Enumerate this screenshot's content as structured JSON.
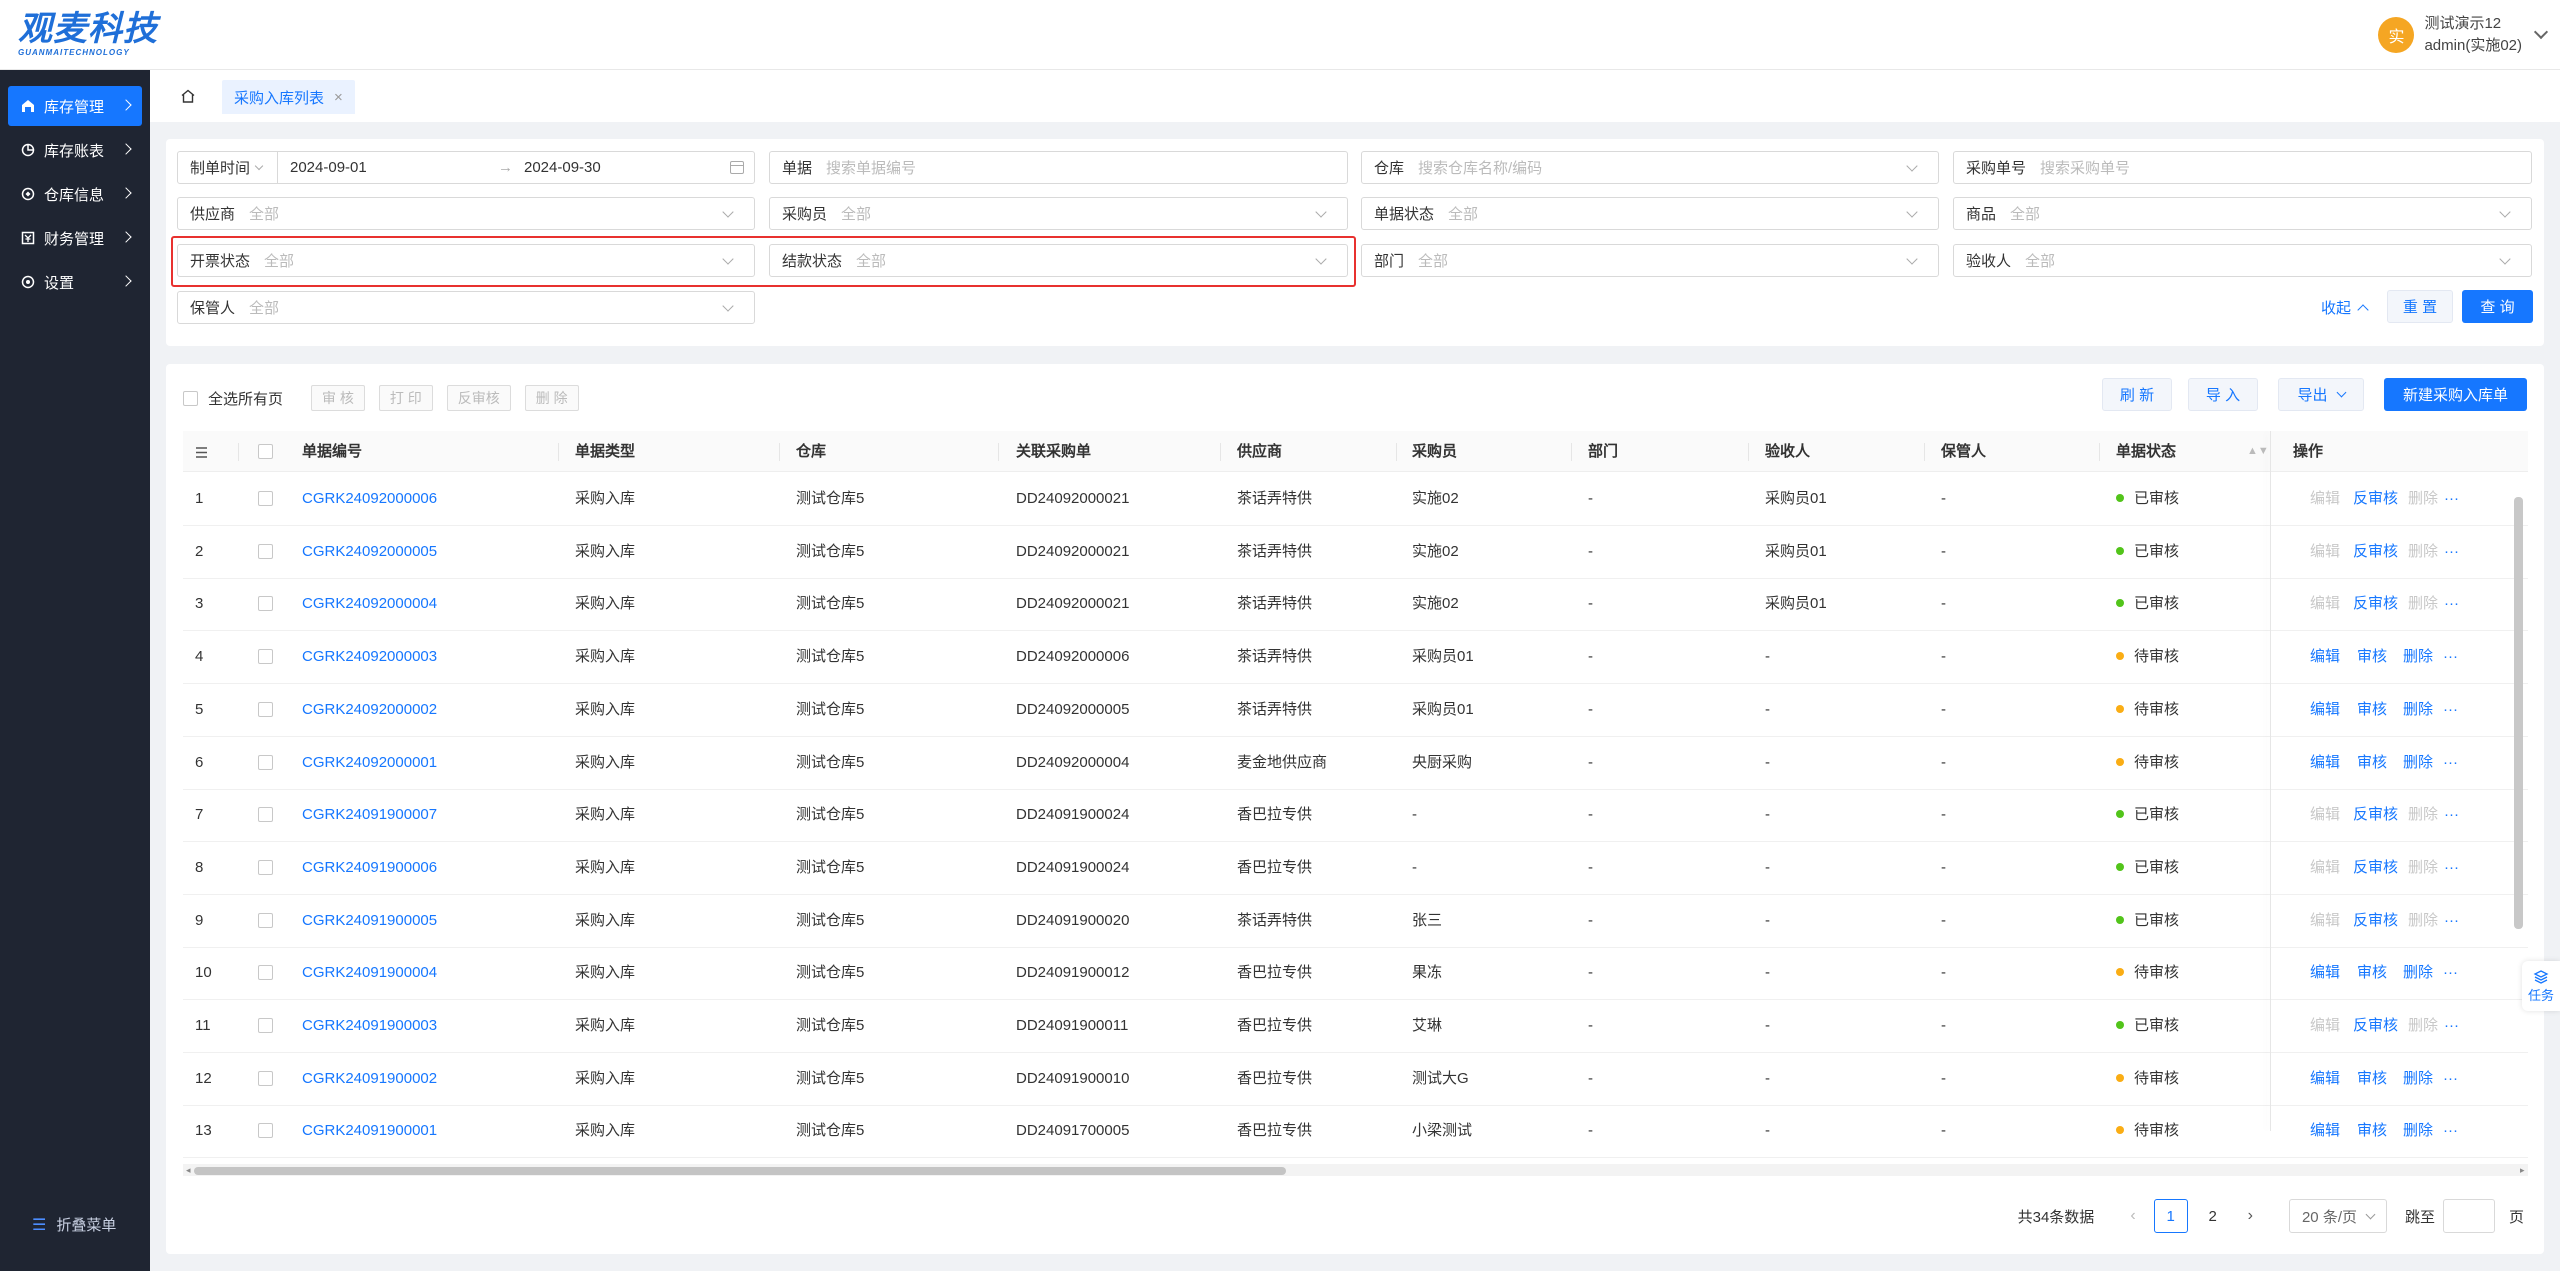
{
  "header": {
    "logo_main": "观麦科技",
    "logo_sub": "GUANMAITECHNOLOGY",
    "avatar_text": "实",
    "user_name": "测试演示12",
    "user_account": "admin(实施02)"
  },
  "sidebar": {
    "items": [
      {
        "label": "库存管理",
        "icon": "warehouse-icon"
      },
      {
        "label": "库存账表",
        "icon": "chart-icon"
      },
      {
        "label": "仓库信息",
        "icon": "info-icon"
      },
      {
        "label": "财务管理",
        "icon": "finance-icon"
      },
      {
        "label": "设置",
        "icon": "settings-icon"
      }
    ],
    "collapse_label": "折叠菜单"
  },
  "tabs": {
    "active_label": "采购入库列表",
    "close": "×"
  },
  "filters": {
    "date_type": "制单时间",
    "date_start": "2024-09-01",
    "date_arrow": "→",
    "date_end": "2024-09-30",
    "doc_label": "单据",
    "doc_placeholder": "搜索单据编号",
    "warehouse_label": "仓库",
    "warehouse_placeholder": "搜索仓库名称/编码",
    "po_label": "采购单号",
    "po_placeholder": "搜索采购单号",
    "supplier_label": "供应商",
    "supplier_value": "全部",
    "buyer_label": "采购员",
    "buyer_value": "全部",
    "doc_status_label": "单据状态",
    "doc_status_value": "全部",
    "product_label": "商品",
    "product_value": "全部",
    "invoice_label": "开票状态",
    "invoice_value": "全部",
    "settle_label": "结款状态",
    "settle_value": "全部",
    "dept_label": "部门",
    "dept_value": "全部",
    "receiver_label": "验收人",
    "receiver_value": "全部",
    "keeper_label": "保管人",
    "keeper_value": "全部",
    "collapse_label": "收起",
    "reset_label": "重 置",
    "query_label": "查 询"
  },
  "toolbar": {
    "select_all_label": "全选所有页",
    "audit": "审 核",
    "print": "打 印",
    "unaudit": "反审核",
    "delete": "删 除",
    "refresh": "刷 新",
    "import": "导 入",
    "export": "导出",
    "create": "新建采购入库单"
  },
  "table": {
    "columns": [
      "单据编号",
      "单据类型",
      "仓库",
      "关联采购单",
      "供应商",
      "采购员",
      "部门",
      "验收人",
      "保管人",
      "单据状态",
      "操作"
    ],
    "rows": [
      {
        "idx": "1",
        "code": "CGRK24092000006",
        "type": "采购入库",
        "warehouse": "测试仓库5",
        "po": "DD24092000021",
        "supplier": "茶话弄特供",
        "buyer": "实施02",
        "dept": "-",
        "receiver": "采购员01",
        "keeper": "-",
        "status": "已审核",
        "status_color": "#52c41a",
        "ops": [
          "编辑",
          "反审核",
          "删除"
        ],
        "ops_enabled": [
          false,
          true,
          false
        ]
      },
      {
        "idx": "2",
        "code": "CGRK24092000005",
        "type": "采购入库",
        "warehouse": "测试仓库5",
        "po": "DD24092000021",
        "supplier": "茶话弄特供",
        "buyer": "实施02",
        "dept": "-",
        "receiver": "采购员01",
        "keeper": "-",
        "status": "已审核",
        "status_color": "#52c41a",
        "ops": [
          "编辑",
          "反审核",
          "删除"
        ],
        "ops_enabled": [
          false,
          true,
          false
        ]
      },
      {
        "idx": "3",
        "code": "CGRK24092000004",
        "type": "采购入库",
        "warehouse": "测试仓库5",
        "po": "DD24092000021",
        "supplier": "茶话弄特供",
        "buyer": "实施02",
        "dept": "-",
        "receiver": "采购员01",
        "keeper": "-",
        "status": "已审核",
        "status_color": "#52c41a",
        "ops": [
          "编辑",
          "反审核",
          "删除"
        ],
        "ops_enabled": [
          false,
          true,
          false
        ]
      },
      {
        "idx": "4",
        "code": "CGRK24092000003",
        "type": "采购入库",
        "warehouse": "测试仓库5",
        "po": "DD24092000006",
        "supplier": "茶话弄特供",
        "buyer": "采购员01",
        "dept": "-",
        "receiver": "-",
        "keeper": "-",
        "status": "待审核",
        "status_color": "#faad14",
        "ops": [
          "编辑",
          "审核",
          "删除"
        ],
        "ops_enabled": [
          true,
          true,
          true
        ]
      },
      {
        "idx": "5",
        "code": "CGRK24092000002",
        "type": "采购入库",
        "warehouse": "测试仓库5",
        "po": "DD24092000005",
        "supplier": "茶话弄特供",
        "buyer": "采购员01",
        "dept": "-",
        "receiver": "-",
        "keeper": "-",
        "status": "待审核",
        "status_color": "#faad14",
        "ops": [
          "编辑",
          "审核",
          "删除"
        ],
        "ops_enabled": [
          true,
          true,
          true
        ]
      },
      {
        "idx": "6",
        "code": "CGRK24092000001",
        "type": "采购入库",
        "warehouse": "测试仓库5",
        "po": "DD24092000004",
        "supplier": "麦金地供应商",
        "buyer": "央厨采购",
        "dept": "-",
        "receiver": "-",
        "keeper": "-",
        "status": "待审核",
        "status_color": "#faad14",
        "ops": [
          "编辑",
          "审核",
          "删除"
        ],
        "ops_enabled": [
          true,
          true,
          true
        ]
      },
      {
        "idx": "7",
        "code": "CGRK24091900007",
        "type": "采购入库",
        "warehouse": "测试仓库5",
        "po": "DD24091900024",
        "supplier": "香巴拉专供",
        "buyer": "-",
        "dept": "-",
        "receiver": "-",
        "keeper": "-",
        "status": "已审核",
        "status_color": "#52c41a",
        "ops": [
          "编辑",
          "反审核",
          "删除"
        ],
        "ops_enabled": [
          false,
          true,
          false
        ]
      },
      {
        "idx": "8",
        "code": "CGRK24091900006",
        "type": "采购入库",
        "warehouse": "测试仓库5",
        "po": "DD24091900024",
        "supplier": "香巴拉专供",
        "buyer": "-",
        "dept": "-",
        "receiver": "-",
        "keeper": "-",
        "status": "已审核",
        "status_color": "#52c41a",
        "ops": [
          "编辑",
          "反审核",
          "删除"
        ],
        "ops_enabled": [
          false,
          true,
          false
        ]
      },
      {
        "idx": "9",
        "code": "CGRK24091900005",
        "type": "采购入库",
        "warehouse": "测试仓库5",
        "po": "DD24091900020",
        "supplier": "茶话弄特供",
        "buyer": "张三",
        "dept": "-",
        "receiver": "-",
        "keeper": "-",
        "status": "已审核",
        "status_color": "#52c41a",
        "ops": [
          "编辑",
          "反审核",
          "删除"
        ],
        "ops_enabled": [
          false,
          true,
          false
        ]
      },
      {
        "idx": "10",
        "code": "CGRK24091900004",
        "type": "采购入库",
        "warehouse": "测试仓库5",
        "po": "DD24091900012",
        "supplier": "香巴拉专供",
        "buyer": "果冻",
        "dept": "-",
        "receiver": "-",
        "keeper": "-",
        "status": "待审核",
        "status_color": "#faad14",
        "ops": [
          "编辑",
          "审核",
          "删除"
        ],
        "ops_enabled": [
          true,
          true,
          true
        ]
      },
      {
        "idx": "11",
        "code": "CGRK24091900003",
        "type": "采购入库",
        "warehouse": "测试仓库5",
        "po": "DD24091900011",
        "supplier": "香巴拉专供",
        "buyer": "艾琳",
        "dept": "-",
        "receiver": "-",
        "keeper": "-",
        "status": "已审核",
        "status_color": "#52c41a",
        "ops": [
          "编辑",
          "反审核",
          "删除"
        ],
        "ops_enabled": [
          false,
          true,
          false
        ]
      },
      {
        "idx": "12",
        "code": "CGRK24091900002",
        "type": "采购入库",
        "warehouse": "测试仓库5",
        "po": "DD24091900010",
        "supplier": "香巴拉专供",
        "buyer": "测试大G",
        "dept": "-",
        "receiver": "-",
        "keeper": "-",
        "status": "待审核",
        "status_color": "#faad14",
        "ops": [
          "编辑",
          "审核",
          "删除"
        ],
        "ops_enabled": [
          true,
          true,
          true
        ]
      },
      {
        "idx": "13",
        "code": "CGRK24091900001",
        "type": "采购入库",
        "warehouse": "测试仓库5",
        "po": "DD24091700005",
        "supplier": "香巴拉专供",
        "buyer": "小梁测试",
        "dept": "-",
        "receiver": "-",
        "keeper": "-",
        "status": "待审核",
        "status_color": "#faad14",
        "ops": [
          "编辑",
          "审核",
          "删除"
        ],
        "ops_enabled": [
          true,
          true,
          true
        ]
      }
    ],
    "more": "···"
  },
  "pagination": {
    "total": "共34条数据",
    "pages": [
      "1",
      "2"
    ],
    "current": "1",
    "page_size": "20 条/页",
    "jump_label": "跳至",
    "page_suffix": "页"
  },
  "task_float": {
    "label": "任务"
  },
  "colors": {
    "primary": "#1677ff",
    "sidebar": "#1f2532",
    "approved": "#52c41a",
    "pending": "#faad14",
    "highlight": "#e8312f"
  }
}
